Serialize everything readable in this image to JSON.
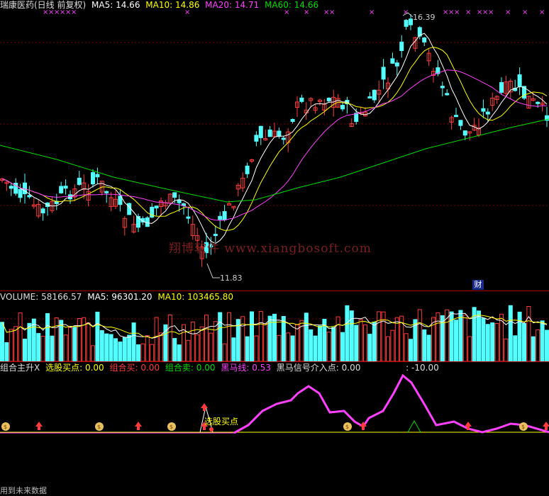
{
  "price_panel": {
    "stock_name": "瑞康医药(日线 前复权)",
    "ma5_label": "MA5:",
    "ma5_value": "14.66",
    "ma10_label": "MA10:",
    "ma10_value": "14.86",
    "ma20_label": "MA20:",
    "ma20_value": "14.71",
    "ma60_label": "MA60:",
    "ma60_value": "14.66",
    "high_marker": "16.39",
    "low_marker": "11.83",
    "watermark": "翔博软件 www.xiangbosoft.com",
    "finance_badge": "财",
    "colors": {
      "up": "#ff3b3b",
      "down": "#54ffff",
      "ma5": "#ffffff",
      "ma10": "#ffff00",
      "ma20": "#ff40ff",
      "ma60": "#00dd00"
    }
  },
  "volume_panel": {
    "volume_label": "VOLUME:",
    "volume_value": "58166.57",
    "ma5_label": "MA5:",
    "ma5_value": "96301.20",
    "ma10_label": "MA10:",
    "ma10_value": "103465.80"
  },
  "indicator_panel": {
    "name": "组合主升X",
    "buy_label": "选股买点:",
    "buy_value": "0.00",
    "combo_buy_label": "组合买:",
    "combo_buy_value": "0.00",
    "combo_sell_label": "组合卖:",
    "combo_sell_value": "0.00",
    "dark_horse_label": "黑马线:",
    "dark_horse_value": "0.53",
    "dark_horse_signal_label": "黑马信号介入点:",
    "dark_horse_signal_value": "0.00",
    "extra_value": ": -10.00",
    "buy_point_text": "选股买点"
  },
  "footer": {
    "text": "用到未来数据"
  }
}
